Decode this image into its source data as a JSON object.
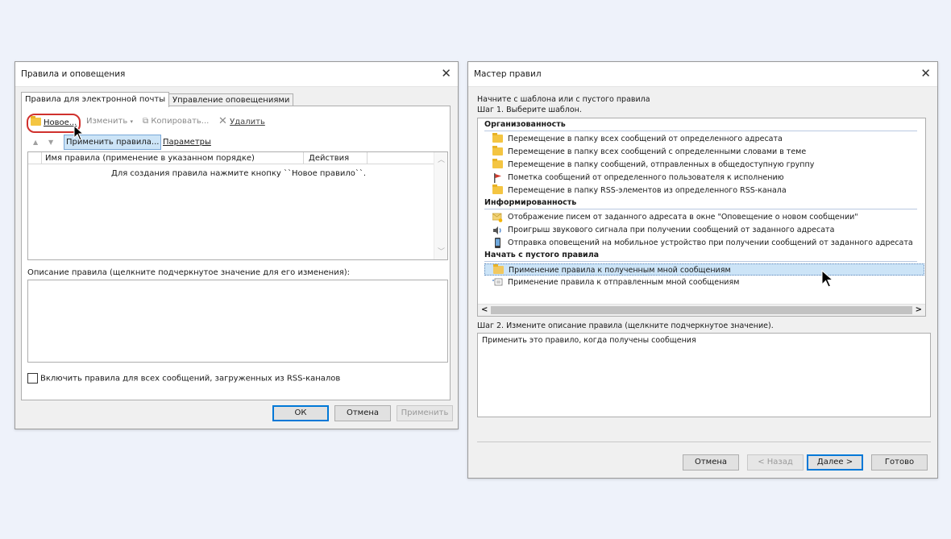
{
  "left_window": {
    "title": "Правила и оповещения",
    "close_glyph": "✕",
    "tabs": [
      "Правила для электронной почты",
      "Управление оповещениями"
    ],
    "toolbar": {
      "new": "Новое...",
      "edit": "Изменить",
      "copy": "Копировать...",
      "delete": "Удалить"
    },
    "toolbar2": {
      "apply": "Применить правила...",
      "options": "Параметры"
    },
    "table": {
      "col_name": "Имя правила (применение в указанном порядке)",
      "col_actions": "Действия",
      "empty_text": "Для создания правила нажмите кнопку ``Новое правило``."
    },
    "description_label": "Описание правила (щелкните подчеркнутое значение для его изменения):",
    "rss_checkbox": "Включить правила для всех сообщений, загруженных из RSS-каналов",
    "buttons": {
      "ok": "ОК",
      "cancel": "Отмена",
      "apply": "Применить"
    }
  },
  "right_window": {
    "title": "Мастер правил",
    "close_glyph": "✕",
    "intro": "Начните с шаблона или с пустого правила",
    "step1": "Шаг 1. Выберите шаблон.",
    "groups": [
      {
        "name": "Организованность",
        "items": [
          {
            "icon": "folder-move-icon",
            "label": "Перемещение в папку всех сообщений от определенного адресата"
          },
          {
            "icon": "folder-move-icon",
            "label": "Перемещение в папку всех сообщений с определенными словами в теме"
          },
          {
            "icon": "folder-move-icon",
            "label": "Перемещение в папку сообщений, отправленных в общедоступную группу"
          },
          {
            "icon": "flag-icon",
            "label": "Пометка сообщений от определенного пользователя к исполнению"
          },
          {
            "icon": "folder-move-icon",
            "label": "Перемещение в папку RSS-элементов из определенного RSS-канала"
          }
        ]
      },
      {
        "name": "Информированность",
        "items": [
          {
            "icon": "alert-mail-icon",
            "label": "Отображение писем от заданного адресата в окне \"Оповещение о новом сообщении\""
          },
          {
            "icon": "speaker-icon",
            "label": "Проигрыш звукового сигнала при получении сообщений от заданного адресата"
          },
          {
            "icon": "mobile-phone-icon",
            "label": "Отправка оповещений на мобильное устройство при получении сообщений от заданного адресата"
          }
        ]
      },
      {
        "name": "Начать с пустого правила",
        "items": [
          {
            "icon": "inbox-rule-icon",
            "label": "Применение правила к полученным мной сообщениям",
            "selected": true
          },
          {
            "icon": "sent-rule-icon",
            "label": "Применение правила к отправленным мной сообщениям"
          }
        ]
      }
    ],
    "step2": "Шаг 2. Измените описание правила (щелкните подчеркнутое значение).",
    "description": "Применить это правило, когда получены сообщения",
    "buttons": {
      "cancel": "Отмена",
      "back": "< Назад",
      "next": "Далее >",
      "finish": "Готово"
    },
    "scroll_left": "<",
    "scroll_right": ">"
  },
  "colors": {
    "selection": "#cce4f7",
    "selection_border": "#7aa8d8",
    "accent": "#0078d7",
    "highlight_ring": "#d0312d"
  }
}
